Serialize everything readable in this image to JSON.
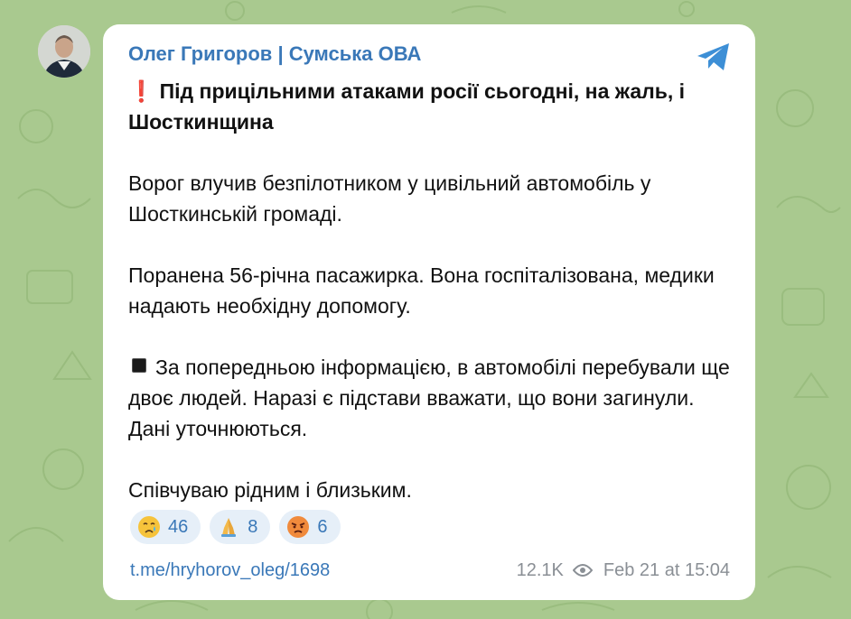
{
  "channel": {
    "author": "Олег Григоров | Сумська ОВА",
    "avatar_label": "author-avatar"
  },
  "message": {
    "headline_emoji": "❗",
    "headline": "Під прицільними атаками росії сьогодні, на жаль, і Шосткинщина",
    "paragraph1": "Ворог влучив безпілотником у цивільний автомобіль у Шосткинській громаді.",
    "paragraph2": "Поранена 56-річна пасажирка. Вона госпіталізована, медики надають необхідну допомогу.",
    "paragraph3": "За попередньою інформацією, в автомобілі перебували ще двоє людей. Наразі є підстави вважати, що вони загинули. Дані уточнюються.",
    "paragraph4": "Співчуваю рідним і близьким."
  },
  "reactions": [
    {
      "emoji": "crying-face",
      "count": "46"
    },
    {
      "emoji": "folded-hands",
      "count": "8"
    },
    {
      "emoji": "angry-face",
      "count": "6"
    }
  ],
  "footer": {
    "link": "t.me/hryhorov_oleg/1698",
    "views": "12.1K",
    "datetime": "Feb 21 at 15:04"
  },
  "colors": {
    "background": "#a9c98f",
    "link": "#3a78b8",
    "muted": "#8a8f95"
  }
}
